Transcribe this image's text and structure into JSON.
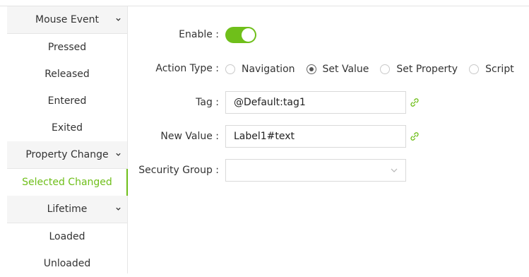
{
  "sidebar": {
    "groups": [
      {
        "label": "Mouse Event",
        "icon": "chevron-down-icon",
        "items": [
          "Pressed",
          "Released",
          "Entered",
          "Exited"
        ]
      },
      {
        "label": "Property Change",
        "icon": "chevron-down-icon",
        "items": [
          "Selected Changed"
        ]
      },
      {
        "label": "Lifetime",
        "icon": "chevron-down-icon",
        "items": [
          "Loaded",
          "Unloaded"
        ]
      }
    ],
    "selected_item": "Selected Changed"
  },
  "form": {
    "enable": {
      "label": "Enable :",
      "value": true
    },
    "action_type": {
      "label": "Action Type :",
      "options": [
        "Navigation",
        "Set Value",
        "Set Property",
        "Script"
      ],
      "selected": "Set Value"
    },
    "tag": {
      "label": "Tag :",
      "value": "@Default:tag1",
      "icon": "link-icon"
    },
    "new_value": {
      "label": "New Value :",
      "value": "Label1#text",
      "icon": "link-icon"
    },
    "security_group": {
      "label": "Security Group :",
      "value": "",
      "icon": "chevron-down-icon"
    }
  },
  "colors": {
    "accent": "#6fbf1a",
    "header_bg": "#f5f5f5",
    "border": "#d9d9d9"
  }
}
